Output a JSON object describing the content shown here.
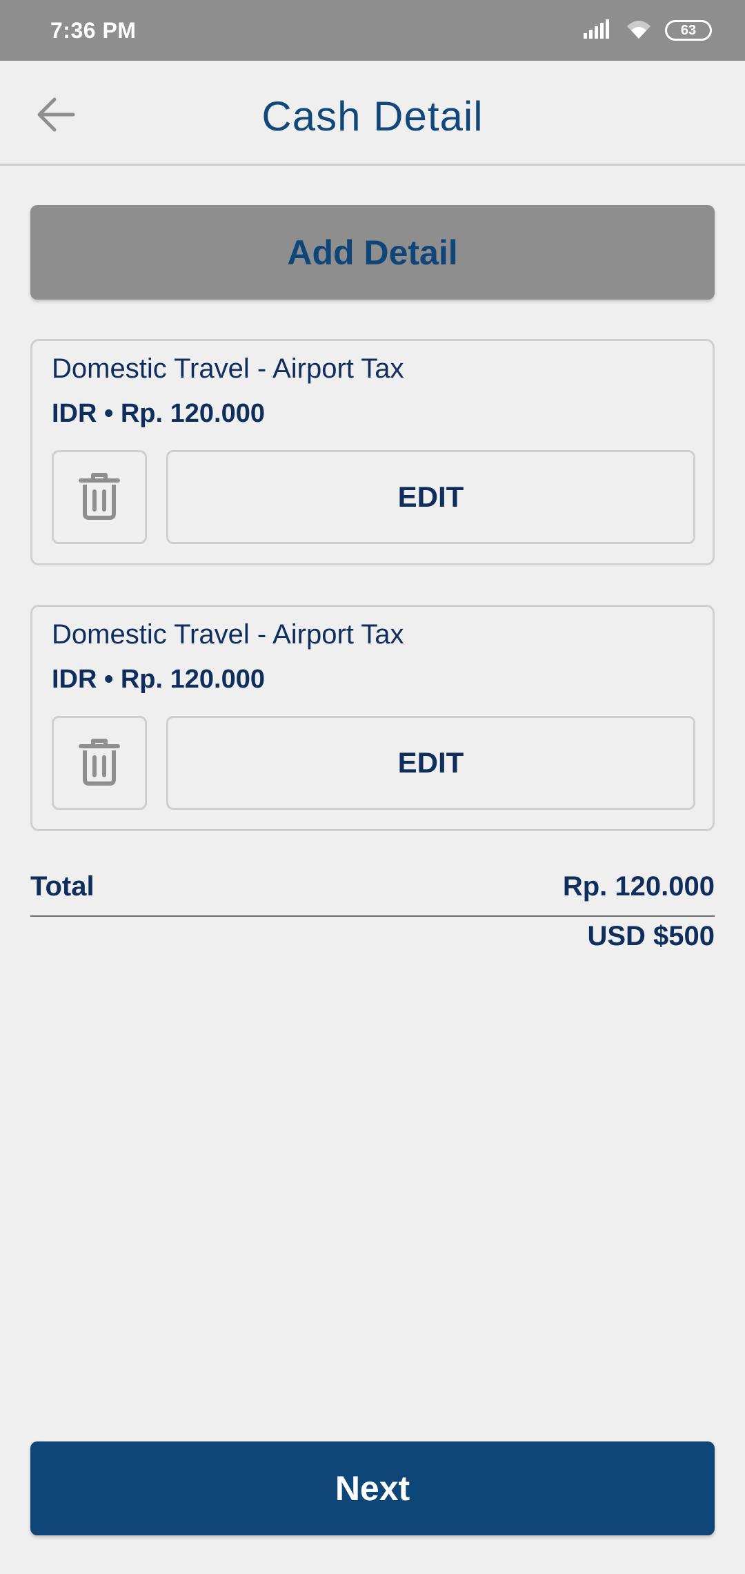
{
  "status_bar": {
    "time": "7:36 PM",
    "battery": "63",
    "icons": [
      "signal-icon",
      "wifi-icon",
      "battery-icon"
    ]
  },
  "header": {
    "title": "Cash Detail",
    "back_icon": "arrow-left-icon"
  },
  "actions": {
    "add_detail_label": "Add Detail",
    "next_label": "Next"
  },
  "details": [
    {
      "title": "Domestic Travel - Airport Tax",
      "amount": "IDR • Rp. 120.000",
      "edit_label": "EDIT",
      "delete_icon": "trash-icon"
    },
    {
      "title": "Domestic Travel - Airport Tax",
      "amount": "IDR • Rp. 120.000",
      "edit_label": "EDIT",
      "delete_icon": "trash-icon"
    }
  ],
  "totals": {
    "label": "Total",
    "idr": "Rp. 120.000",
    "usd": "USD $500"
  },
  "colors": {
    "primary": "#0d4677",
    "text": "#0f2e5c",
    "secondary_button": "#8e8e8e",
    "background": "#efeff0"
  }
}
